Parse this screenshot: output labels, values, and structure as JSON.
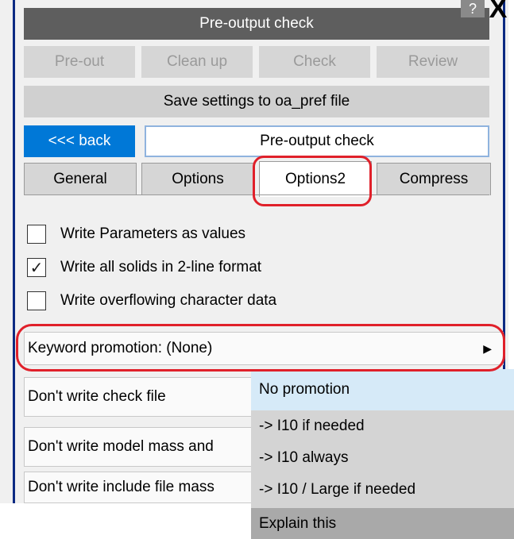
{
  "window": {
    "title": "Pre-output check",
    "help_label": "?",
    "close_label": "X"
  },
  "toolbar": {
    "pre_out": "Pre-out",
    "clean_up": "Clean up",
    "check": "Check",
    "review": "Review",
    "save_settings": "Save settings to oa_pref file"
  },
  "nav": {
    "back_label": "<<< back",
    "current_page": "Pre-output check"
  },
  "tabs": [
    "General",
    "Options",
    "Options2",
    "Compress"
  ],
  "active_tab": "Options2",
  "options": [
    {
      "label": "Write Parameters as values",
      "checked": false,
      "mark": ""
    },
    {
      "label": "Write all solids in 2-line format",
      "checked": true,
      "mark": "✓"
    },
    {
      "label": "Write overflowing character data",
      "checked": false,
      "mark": ""
    }
  ],
  "keyword_promotion": {
    "label": "Keyword promotion: (None)",
    "arrow": "▶"
  },
  "rows": [
    "Don't write check file",
    "Don't write model mass and",
    "Don't write include file mass"
  ],
  "menu": {
    "items": [
      "No promotion",
      "-> I10 if needed",
      "-> I10 always",
      "-> I10 / Large if needed",
      "Explain this"
    ],
    "selected": "No promotion"
  },
  "colors": {
    "title_bar": "#5e5e5e",
    "back_button": "#0078d7",
    "highlight": "#e0202a",
    "window_border": "#0c2a82"
  }
}
